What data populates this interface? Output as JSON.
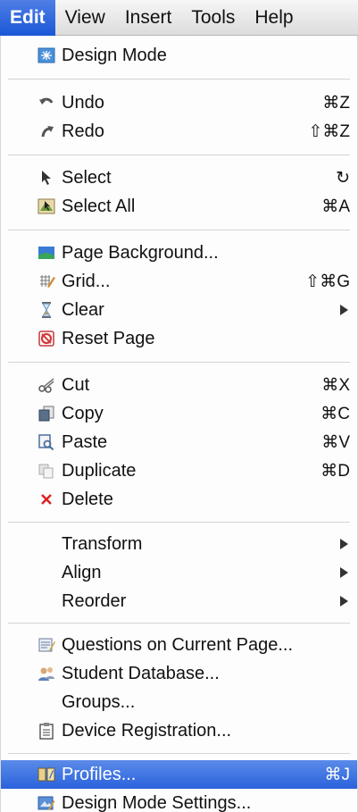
{
  "menubar": {
    "items": [
      "Edit",
      "View",
      "Insert",
      "Tools",
      "Help"
    ],
    "active": "Edit"
  },
  "menu": {
    "design_mode": {
      "label": "Design Mode",
      "icon": "design-mode-icon"
    },
    "undo": {
      "label": "Undo",
      "shortcut": "⌘Z",
      "icon": "undo-icon"
    },
    "redo": {
      "label": "Redo",
      "shortcut": "⇧⌘Z",
      "icon": "redo-icon"
    },
    "select": {
      "label": "Select",
      "shortcut": "↻",
      "icon": "pointer-icon"
    },
    "select_all": {
      "label": "Select All",
      "shortcut": "⌘A",
      "icon": "select-all-icon"
    },
    "page_background": {
      "label": "Page Background...",
      "icon": "landscape-icon"
    },
    "grid": {
      "label": "Grid...",
      "shortcut": "⇧⌘G",
      "icon": "grid-icon"
    },
    "clear": {
      "label": "Clear",
      "icon": "hourglass-icon"
    },
    "reset_page": {
      "label": "Reset Page",
      "icon": "reset-icon"
    },
    "cut": {
      "label": "Cut",
      "shortcut": "⌘X",
      "icon": "scissors-icon"
    },
    "copy": {
      "label": "Copy",
      "shortcut": "⌘C",
      "icon": "copy-icon"
    },
    "paste": {
      "label": "Paste",
      "shortcut": "⌘V",
      "icon": "paste-icon"
    },
    "duplicate": {
      "label": "Duplicate",
      "shortcut": "⌘D",
      "icon": "duplicate-icon"
    },
    "delete": {
      "label": "Delete",
      "icon": "delete-x-icon"
    },
    "transform": {
      "label": "Transform"
    },
    "align": {
      "label": "Align"
    },
    "reorder": {
      "label": "Reorder"
    },
    "questions": {
      "label": "Questions on Current Page...",
      "icon": "questions-icon"
    },
    "student_db": {
      "label": "Student Database...",
      "icon": "students-icon"
    },
    "groups": {
      "label": "Groups..."
    },
    "device_registration": {
      "label": "Device Registration...",
      "icon": "clipboard-icon"
    },
    "profiles": {
      "label": "Profiles...",
      "shortcut": "⌘J",
      "icon": "profiles-icon"
    },
    "design_mode_settings": {
      "label": "Design Mode Settings...",
      "icon": "settings-icon"
    }
  },
  "colors": {
    "highlight": "#2a62dc",
    "separator": "#d4d4d4"
  }
}
